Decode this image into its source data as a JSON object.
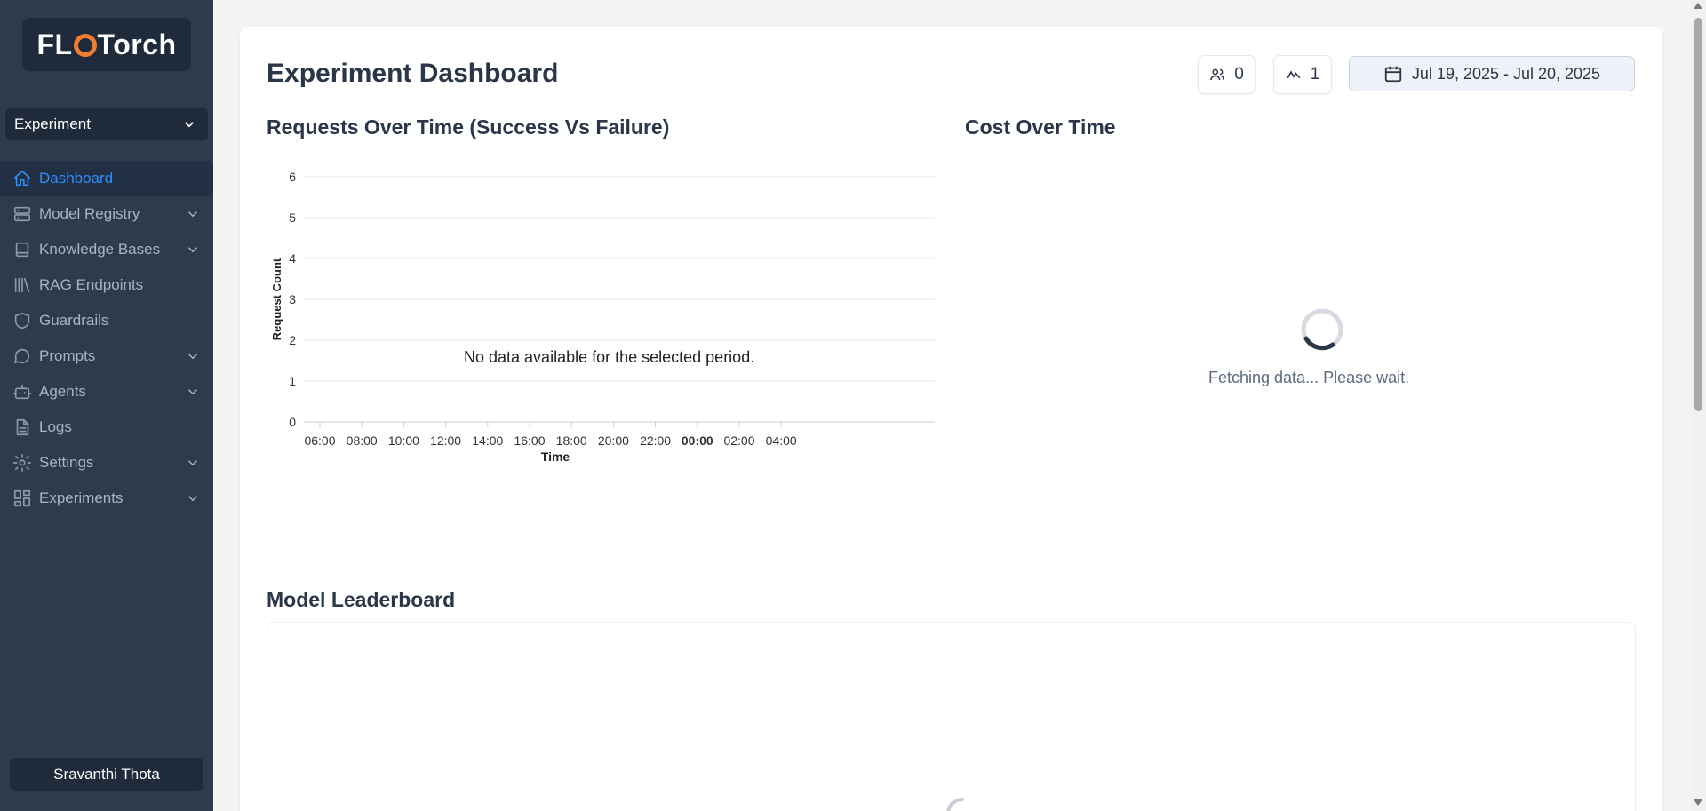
{
  "logo": {
    "prefix": "FL",
    "suffix": "Torch"
  },
  "selector": {
    "value": "Experiment"
  },
  "nav": [
    {
      "label": "Dashboard",
      "icon": "home-icon",
      "active": true,
      "expandable": false
    },
    {
      "label": "Model Registry",
      "icon": "server-icon",
      "expandable": true
    },
    {
      "label": "Knowledge Bases",
      "icon": "book-icon",
      "expandable": true
    },
    {
      "label": "RAG Endpoints",
      "icon": "library-icon",
      "expandable": false
    },
    {
      "label": "Guardrails",
      "icon": "shield-icon",
      "expandable": false
    },
    {
      "label": "Prompts",
      "icon": "message-icon",
      "expandable": true
    },
    {
      "label": "Agents",
      "icon": "bot-icon",
      "expandable": true
    },
    {
      "label": "Logs",
      "icon": "file-text-icon",
      "expandable": false
    },
    {
      "label": "Settings",
      "icon": "gear-icon",
      "expandable": true
    },
    {
      "label": "Experiments",
      "icon": "grid-icon",
      "expandable": true
    }
  ],
  "user": {
    "name": "Sravanthi Thota"
  },
  "header": {
    "title": "Experiment Dashboard",
    "users_count": "0",
    "activity_count": "1",
    "date_range": "Jul 19, 2025 - Jul 20, 2025"
  },
  "requests_chart": {
    "title": "Requests Over Time (Success Vs Failure)",
    "empty_message": "No data available for the selected period."
  },
  "cost_chart": {
    "title": "Cost Over Time",
    "loading_message": "Fetching data... Please wait."
  },
  "leaderboard": {
    "title": "Model Leaderboard"
  },
  "chart_data": {
    "type": "line",
    "title": "Requests Over Time (Success Vs Failure)",
    "xlabel": "Time",
    "ylabel": "Request Count",
    "x_ticks": [
      "06:00",
      "08:00",
      "10:00",
      "12:00",
      "14:00",
      "16:00",
      "18:00",
      "20:00",
      "22:00",
      "00:00",
      "02:00",
      "04:00"
    ],
    "y_ticks": [
      0,
      1,
      2,
      3,
      4,
      5,
      6
    ],
    "ylim": [
      0,
      6
    ],
    "grid": true,
    "series": []
  },
  "colors": {
    "sidebar": "#2f3b4d",
    "active": "#2f8cff",
    "accent": "#ef7d2f"
  }
}
